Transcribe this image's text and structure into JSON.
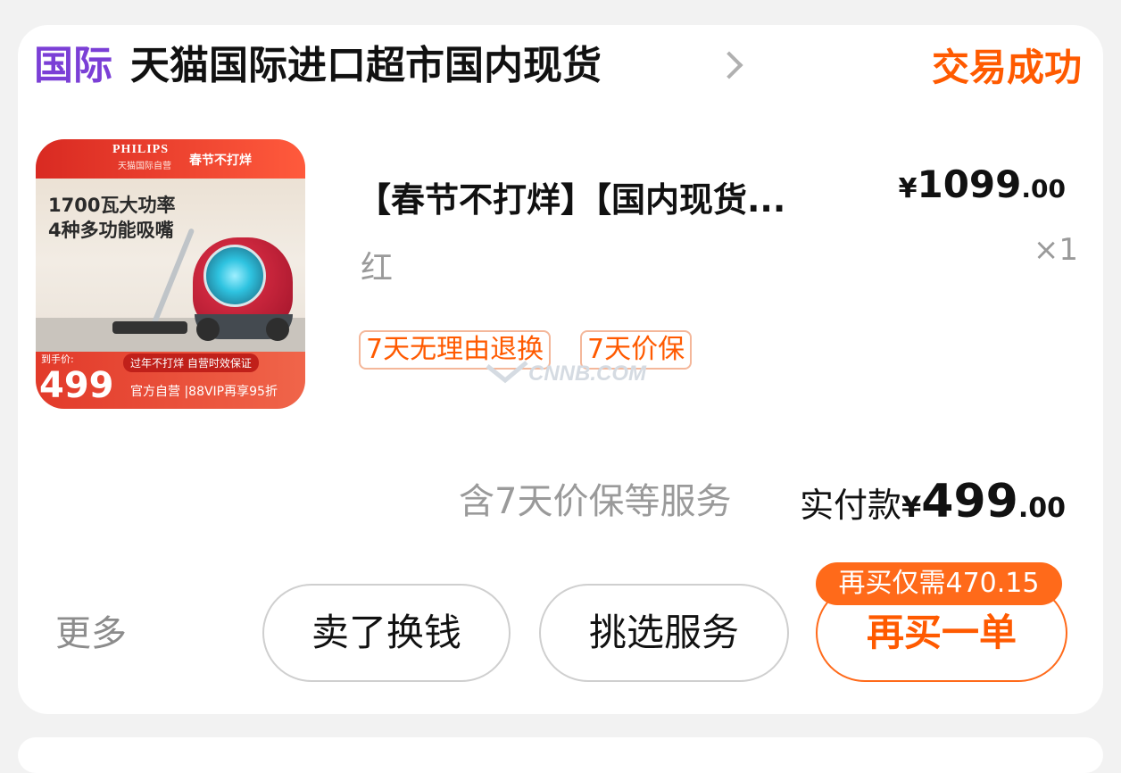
{
  "shop": {
    "badge": "国际",
    "name": "天猫国际进口超市国内现货",
    "status": "交易成功"
  },
  "product": {
    "image": {
      "brand": "PHILIPS",
      "brand_sub": "天猫国际自营",
      "tag": "春节不打烊",
      "line1": "1700瓦大功率",
      "line2": "4种多功能吸嘴",
      "promo": "过年不打烊 自营时效保证",
      "price_label": "到手价:",
      "price": "499",
      "bottom_text": "官方自营 |88VIP再享95折"
    },
    "title": "【春节不打烊】【国内现货...",
    "variant": "红",
    "price": {
      "yen": "¥",
      "int": "1099",
      "dec": ".00"
    },
    "quantity": "×1",
    "tags": [
      "7天无理由退换",
      "7天价保"
    ]
  },
  "totals": {
    "service_note": "含7天价保等服务",
    "paid_label": "实付款",
    "paid_yen": "¥",
    "paid_int": "499",
    "paid_dec": ".00"
  },
  "footer": {
    "more": "更多",
    "buttons": [
      "卖了换钱",
      "挑选服务",
      "再买一单"
    ],
    "rebuy_badge": "再买仅需470.15"
  },
  "watermark": "CNNB.COM",
  "colors": {
    "accent_orange": "#ff5a00",
    "intl_purple": "#7b3fd6"
  }
}
